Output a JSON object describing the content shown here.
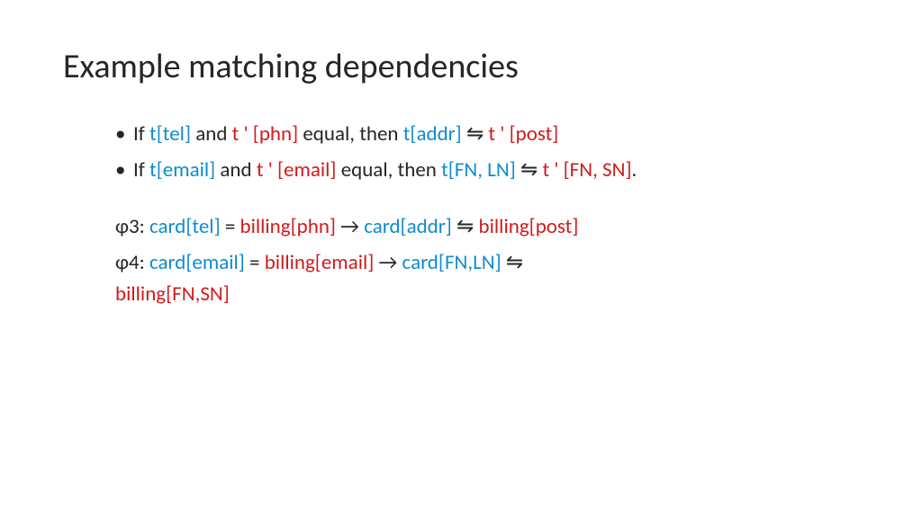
{
  "title": "Example matching dependencies",
  "bullet1": {
    "s1": "If ",
    "s2": "t[tel]",
    "s3": " and ",
    "s4": "t ' [phn]",
    "s5": " equal, then ",
    "s6": "t[addr]",
    "s7": " ",
    "s8": "⇋",
    "s9": " ",
    "s10": "t ' [post]"
  },
  "bullet2": {
    "s1": "If ",
    "s2": "t[email]",
    "s3": " and ",
    "s4": "t ' [email]",
    "s5": " equal, then ",
    "s6": "t[FN, LN]",
    "s7": " ",
    "s8": "⇋",
    "s9": " ",
    "s10": "t ' [FN, SN]",
    "s11": "."
  },
  "phi3": {
    "label": "φ3: ",
    "s1": "card[tel]",
    "s2": " = ",
    "s3": "billing[phn]",
    "s4": " → ",
    "s5": "card[addr]",
    "s6": " ",
    "s7": "⇋",
    "s8": " ",
    "s9": "billing[post]"
  },
  "phi4": {
    "label": "φ4: ",
    "s1": "card[email]",
    "s2": " = ",
    "s3": "billing[email]",
    "s4": " → ",
    "s5": "card[FN,LN]",
    "s6": " ",
    "s7": "⇋",
    "s8": " ",
    "s9": "billing[FN,SN]"
  }
}
